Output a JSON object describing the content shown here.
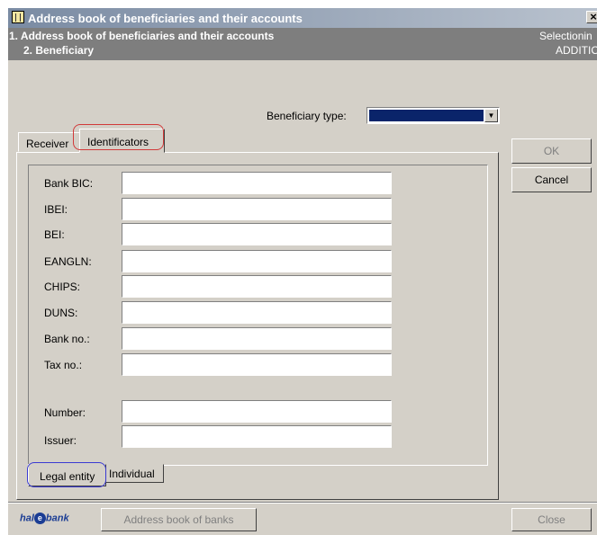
{
  "window": {
    "title": "Address book of beneficiaries and their accounts",
    "close_glyph": "×"
  },
  "header": {
    "line1": "1. Address book of beneficiaries and their accounts",
    "line2": "2. Beneficiary",
    "right1": "Selectionin",
    "right2": "ADDITION"
  },
  "beneficiary_type": {
    "label": "Beneficiary type:",
    "value": ""
  },
  "tabs": [
    {
      "label": "Receiver"
    },
    {
      "label": "Identificators"
    }
  ],
  "fields": [
    {
      "label": "Bank BIC:",
      "value": ""
    },
    {
      "label": "IBEI:",
      "value": ""
    },
    {
      "label": "BEI:",
      "value": ""
    },
    {
      "label": "EANGLN:",
      "value": ""
    },
    {
      "label": "CHIPS:",
      "value": ""
    },
    {
      "label": "DUNS:",
      "value": ""
    },
    {
      "label": "Bank no.:",
      "value": ""
    },
    {
      "label": "Tax no.:",
      "value": ""
    },
    {
      "label": "Number:",
      "value": ""
    },
    {
      "label": "Issuer:",
      "value": ""
    }
  ],
  "bottom_tabs": [
    {
      "label": "Legal entity"
    },
    {
      "label": "Individual"
    }
  ],
  "buttons": {
    "ok": "OK",
    "cancel": "Cancel",
    "address_book_banks": "Address book of banks",
    "close": "Close"
  },
  "logo": {
    "pre": "hal",
    "mark": "e",
    "post": "bank"
  },
  "colors": {
    "selection_blue": "#0a246a",
    "highlight_red": "#d23a3a",
    "highlight_blue": "#3a3ad2"
  }
}
